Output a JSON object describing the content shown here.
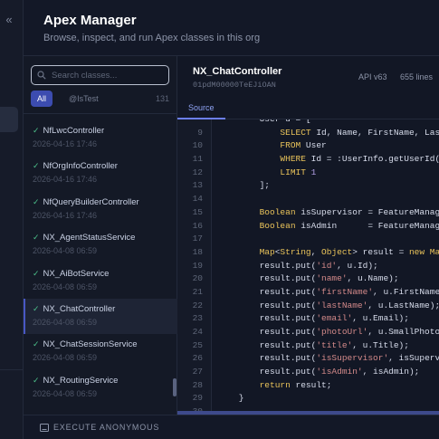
{
  "app": {
    "title": "Apex Manager",
    "subtitle": "Browse, inspect, and run Apex classes in this org"
  },
  "rail": {
    "collapse_icon": "«"
  },
  "search": {
    "placeholder": "Search classes..."
  },
  "filters": {
    "all_label": "All",
    "istest_label": "@IsTest",
    "count": "131"
  },
  "classes": [
    {
      "name": "NfLwcController",
      "date": "2026-04-16 17:46"
    },
    {
      "name": "NfOrgInfoController",
      "date": "2026-04-16 17:46"
    },
    {
      "name": "NfQueryBuilderController",
      "date": "2026-04-16 17:46"
    },
    {
      "name": "NX_AgentStatusService",
      "date": "2026-04-08 06:59"
    },
    {
      "name": "NX_AiBotService",
      "date": "2026-04-08 06:59"
    },
    {
      "name": "NX_ChatController",
      "date": "2026-04-08 06:59"
    },
    {
      "name": "NX_ChatSessionService",
      "date": "2026-04-08 06:59"
    },
    {
      "name": "NX_RoutingService",
      "date": "2026-04-08 06:59"
    }
  ],
  "selected_index": 5,
  "detail": {
    "class_name": "NX_ChatController",
    "class_id": "01pdM00000TeEJiOAN",
    "api_version": "API v63",
    "line_count": "655 lines",
    "tab_source": "Source"
  },
  "code": {
    "lines": [
      {
        "n": "",
        "html": "        User u = ["
      },
      {
        "n": "9",
        "html": "            <span class=\"kw\">SELECT</span> Id, Name, FirstName, LastName"
      },
      {
        "n": "10",
        "html": "            <span class=\"kw\">FROM</span> User"
      },
      {
        "n": "11",
        "html": "            <span class=\"kw\">WHERE</span> Id = :UserInfo.getUserId()"
      },
      {
        "n": "12",
        "html": "            <span class=\"kw\">LIMIT</span> <span class=\"num\">1</span>"
      },
      {
        "n": "13",
        "html": "        ];"
      },
      {
        "n": "14",
        "html": ""
      },
      {
        "n": "15",
        "html": "        <span class=\"ty\">Boolean</span> isSupervisor = FeatureManagement"
      },
      {
        "n": "16",
        "html": "        <span class=\"ty\">Boolean</span> isAdmin      = FeatureManagement"
      },
      {
        "n": "17",
        "html": ""
      },
      {
        "n": "18",
        "html": "        <span class=\"ty\">Map</span>&lt;<span class=\"ty\">String</span>, <span class=\"ty\">Object</span>&gt; result = <span class=\"kw\">new</span> <span class=\"ty\">Map</span>"
      },
      {
        "n": "19",
        "html": "        result.put(<span class=\"str\">'id'</span>, u.Id);"
      },
      {
        "n": "20",
        "html": "        result.put(<span class=\"str\">'name'</span>, u.Name);"
      },
      {
        "n": "21",
        "html": "        result.put(<span class=\"str\">'firstName'</span>, u.FirstName);"
      },
      {
        "n": "22",
        "html": "        result.put(<span class=\"str\">'lastName'</span>, u.LastName);"
      },
      {
        "n": "23",
        "html": "        result.put(<span class=\"str\">'email'</span>, u.Email);"
      },
      {
        "n": "24",
        "html": "        result.put(<span class=\"str\">'photoUrl'</span>, u.SmallPhotoUrl"
      },
      {
        "n": "25",
        "html": "        result.put(<span class=\"str\">'title'</span>, u.Title);"
      },
      {
        "n": "26",
        "html": "        result.put(<span class=\"str\">'isSupervisor'</span>, isSupervisor"
      },
      {
        "n": "27",
        "html": "        result.put(<span class=\"str\">'isAdmin'</span>, isAdmin);"
      },
      {
        "n": "28",
        "html": "        <span class=\"kw\">return</span> result;"
      },
      {
        "n": "29",
        "html": "    }"
      },
      {
        "n": "30",
        "html": ""
      }
    ]
  },
  "bottom": {
    "execute_label": "EXECUTE ANONYMOUS"
  }
}
